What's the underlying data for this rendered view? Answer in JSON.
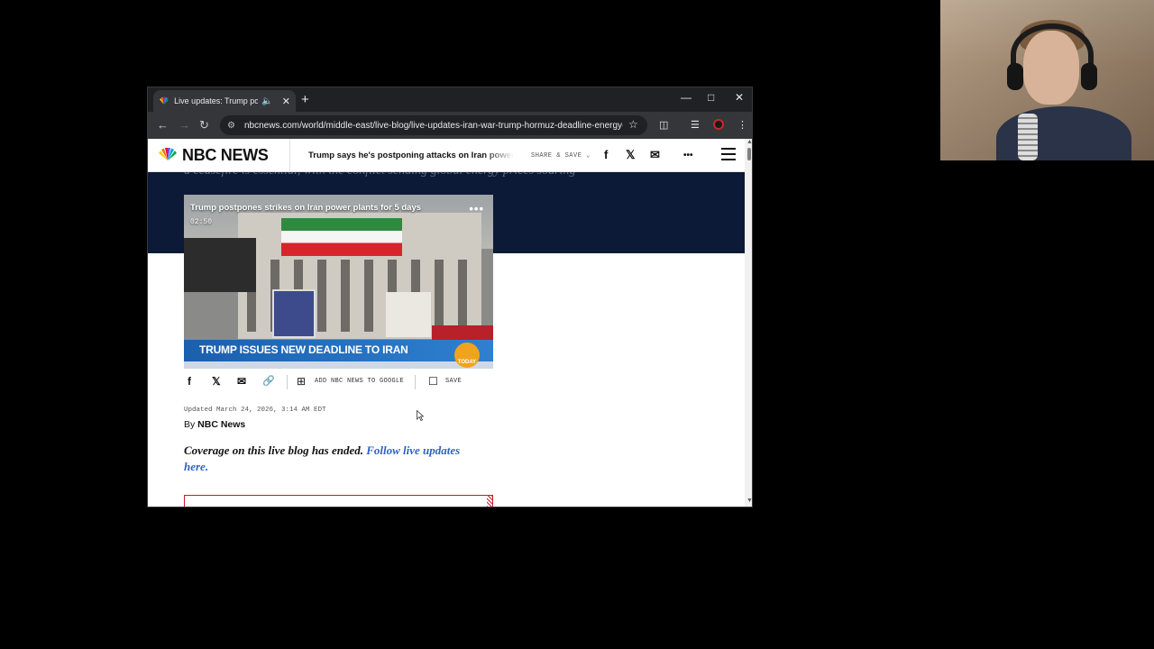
{
  "browser": {
    "tab_title": "Live updates: Trump postpones strikes on Iran power plants",
    "new_tab": "+",
    "url": "nbcnews.com/world/middle-east/live-blog/live-updates-iran-war-trump-hormuz-deadline-energy-cr..."
  },
  "site": {
    "logo_text": "NBC NEWS",
    "headline": "Trump says he's postponing attacks on Iran power plants",
    "share_save": "SHARE & SAVE ⌄",
    "behind_text": "a ceasefire is essential, with the conflict sending global energy prices soaring"
  },
  "video": {
    "title": "Trump postpones strikes on Iran power plants for 5 days",
    "duration": "02:50",
    "lower_third": "TRUMP ISSUES NEW DEADLINE TO IRAN",
    "brand_badge": "TODAY"
  },
  "share_bar": {
    "add_to_google": "ADD NBC NEWS TO GOOGLE",
    "save": "SAVE"
  },
  "article": {
    "updated": "Updated March 24, 2026, 3:14 AM EDT",
    "byline_prefix": "By ",
    "byline_author": "NBC News",
    "coverage_text": "Coverage on this live blog has ended. ",
    "coverage_link": "Follow live updates here."
  },
  "icons": {
    "facebook": "f",
    "x": "𝕏",
    "email": "✉",
    "link": "🔗",
    "more": "•••"
  }
}
